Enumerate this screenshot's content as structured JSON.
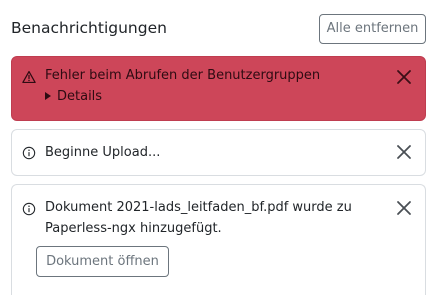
{
  "header": {
    "title": "Benachrichtigungen",
    "clear_all_label": "Alle entfernen"
  },
  "notifications": [
    {
      "type": "error",
      "icon": "warning-triangle-icon",
      "message": "Fehler beim Abrufen der Benutzergruppen",
      "details_label": "Details",
      "close_icon": "close-icon"
    },
    {
      "type": "info",
      "icon": "info-circle-icon",
      "message": "Beginne Upload...",
      "close_icon": "close-icon"
    },
    {
      "type": "info",
      "icon": "info-circle-icon",
      "message_line1": "Dokument 2021-lads_leitfaden_bf.pdf wurde zu",
      "message_line2": "Paperless-ngx hinzugefügt.",
      "action_label": "Dokument öffnen",
      "close_icon": "close-icon"
    }
  ],
  "colors": {
    "error_background": "#cd4659",
    "error_text": "#2e0b12",
    "info_border": "#d9dde1",
    "secondary_button": "#6c757d"
  }
}
